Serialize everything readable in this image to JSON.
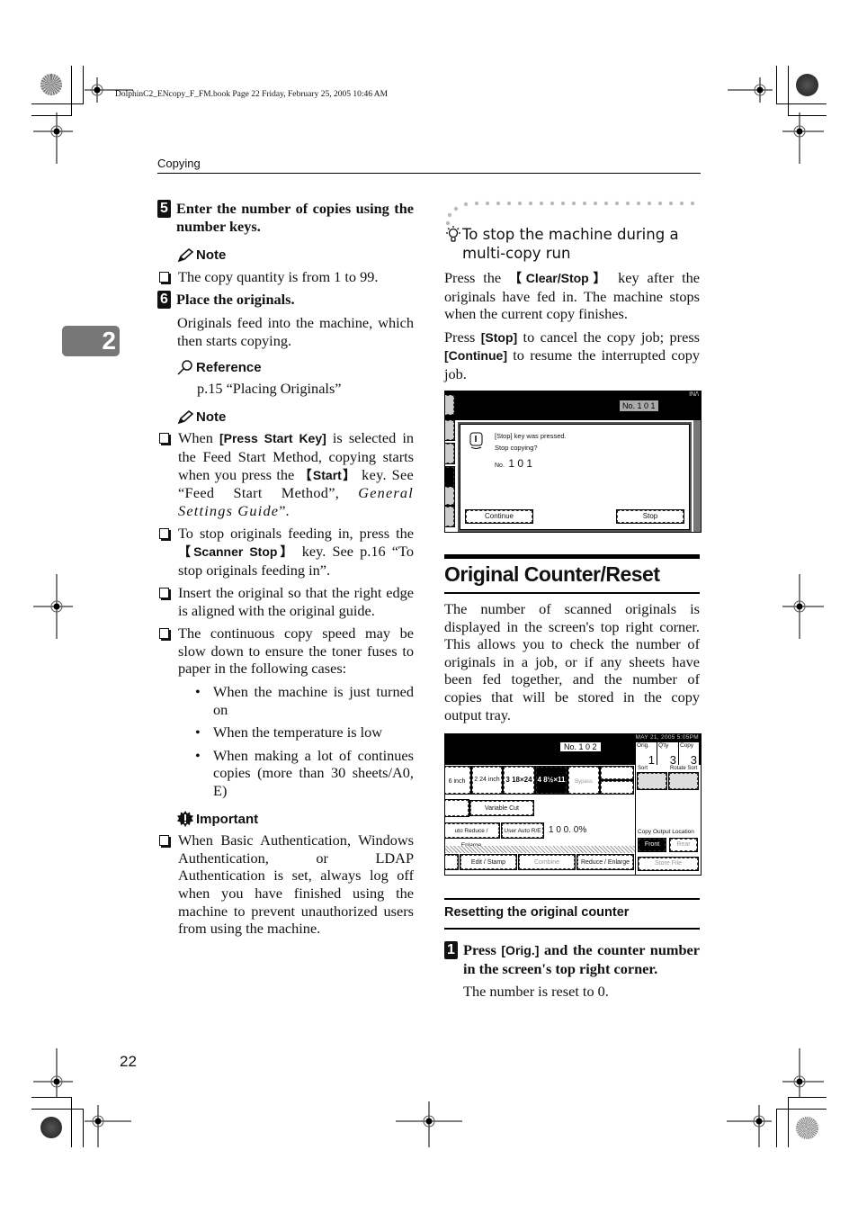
{
  "book_info": "DolphinC2_ENcopy_F_FM.book  Page 22  Friday, February 25, 2005  10:46 AM",
  "running_head": "Copying",
  "chapter_tab": "2",
  "page_number": "22",
  "left_column": {
    "step5": {
      "number": "5",
      "text": "Enter the number of copies using the number keys."
    },
    "note1": {
      "title": "Note",
      "items": [
        "The copy quantity is from 1 to 99."
      ]
    },
    "step6": {
      "number": "6",
      "text": "Place the originals.",
      "body": "Originals feed into the machine, which then starts copying."
    },
    "reference": {
      "title": "Reference",
      "text": "p.15 “Placing Originals”"
    },
    "note2": {
      "title": "Note",
      "item1": {
        "pre": "When ",
        "key1": "[Press Start Key]",
        "mid": " is selected in the Feed Start Method, copying starts when you press the ",
        "key2": "【Start】",
        "post": " key. See “Feed Start Method”, ",
        "italic": "General Settings Guide",
        "end": "”."
      },
      "item2": {
        "pre": "To stop originals feeding in, press the ",
        "key": "【Scanner Stop】",
        "post": " key. See p.16 “To stop originals feeding in”."
      },
      "item3": "Insert the original so that the right edge is aligned with the original guide.",
      "item4": "The continuous copy speed may be slow down to ensure the toner fuses to paper in the following cases:",
      "bullets": [
        "When the machine is just turned on",
        "When the temperature is low",
        "When making a lot of continues copies (more than 30 sheets/A0, E)"
      ]
    },
    "important": {
      "title": "Important",
      "items": [
        "When Basic Authentication, Windows Authentication, or LDAP Authentication is set, always log off when you have finished using the machine to prevent unauthorized users from using the machine."
      ]
    }
  },
  "right_column": {
    "tip": {
      "title": "To stop the machine during a multi-copy run",
      "p1": {
        "pre": "Press the ",
        "key": "【Clear/Stop】",
        "post": " key after the originals have fed in. The machine stops when the current copy finishes."
      },
      "p2": {
        "pre": "Press ",
        "key1": "[Stop]",
        "mid": " to cancel the copy job; press ",
        "key2": "[Continue]",
        "post": " to resume the interrupted copy job."
      }
    },
    "screen1": {
      "corner": "IN/\\",
      "counter": "No. 1 0 1",
      "message_line1": "[Stop] key was pressed.",
      "message_line2": "Stop copying?",
      "number_prefix": "No.",
      "number": "1 0 1",
      "continue_button": "Continue",
      "stop_button": "Stop"
    },
    "section_title": "Original Counter/Reset",
    "section_body": "The number of scanned originals is displayed in the screen's top right corner. This allows you to check the number of originals in a job, or if any sheets have been fed together, and the number of copies that will be stored in the copy output tray.",
    "screen2": {
      "date": "MAY  21, 2005  5:05PM",
      "counter": "No. 1 0 2",
      "orig_label": "Orig.",
      "orig_value": "1",
      "qty_label": "Q'ty",
      "qty_value": "3",
      "copy_label": "Copy",
      "copy_value": "3",
      "paper_trays": [
        {
          "label": "6 inch",
          "selected": false
        },
        {
          "label": "2  24 inch",
          "selected": false
        },
        {
          "label": "3  18×24",
          "selected": false
        },
        {
          "label": "4  8½×11",
          "selected": true
        },
        {
          "label": "Bypass",
          "selected": false
        }
      ],
      "variable_cut": "Variable Cut",
      "auto_reduce": "uto Reduce / Enlarge",
      "user_auto": "User Auto R/E",
      "ratio": "1 0 0. 0%",
      "sort_label": "Sort",
      "rotate_sort_label": "Rotate Sort",
      "copy_output_location": "Copy Output Location",
      "front_button": "Front",
      "rear_button": "Rear",
      "store_file_button": "Store File",
      "bottom_tabs": [
        "Edit / Stamp",
        "Combine",
        "Reduce / Enlarge"
      ]
    },
    "subsection_title": "Resetting the original counter",
    "step1": {
      "number": "1",
      "pre": "Press ",
      "key": "[Orig.]",
      "post": " and the counter number in the screen's top right corner.",
      "result": "The number is reset to 0."
    }
  }
}
